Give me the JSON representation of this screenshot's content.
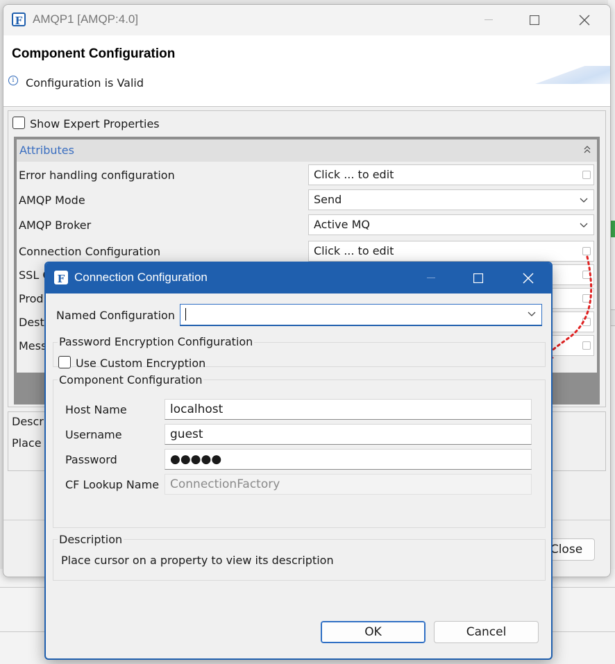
{
  "outer_window": {
    "title": "AMQP1 [AMQP:4.0]",
    "header_title": "Component Configuration",
    "status": "Configuration is Valid",
    "show_expert_label": "Show Expert Properties",
    "attributes_header": "Attributes",
    "properties": [
      {
        "label": "Error handling configuration",
        "value": "Click ... to edit",
        "kind": "edit"
      },
      {
        "label": "AMQP Mode",
        "value": "Send",
        "kind": "select"
      },
      {
        "label": "AMQP Broker",
        "value": "Active MQ",
        "kind": "select"
      },
      {
        "label": "Connection Configuration",
        "value": "Click ... to edit",
        "kind": "edit"
      },
      {
        "label": "SSL C",
        "value": "",
        "kind": "edit"
      },
      {
        "label": "Prod",
        "value": "",
        "kind": "edit"
      },
      {
        "label": "Desti",
        "value": "",
        "kind": "edit"
      },
      {
        "label": "Mess",
        "value": "",
        "kind": "edit"
      }
    ],
    "description_title": "Descri",
    "description_text": "Place c",
    "close_button": "Close"
  },
  "dialog": {
    "title": "Connection Configuration",
    "named_config_label": "Named Configuration",
    "named_config_value": "",
    "password_encryption_group": "Password Encryption Configuration",
    "use_custom_encryption_label": "Use Custom Encryption",
    "component_config_group": "Component Configuration",
    "fields": [
      {
        "label": "Host Name",
        "value": "localhost",
        "disabled": false
      },
      {
        "label": "Username",
        "value": "guest",
        "disabled": false
      },
      {
        "label": "Password",
        "value": "●●●●●",
        "disabled": false
      },
      {
        "label": "CF Lookup Name",
        "value": "ConnectionFactory",
        "disabled": true
      }
    ],
    "description_group": "Description",
    "description_text": "Place cursor on a property to view its description",
    "ok_button": "OK",
    "cancel_button": "Cancel"
  },
  "colors": {
    "dialog_titlebar": "#1f5fae",
    "attributes_header_text": "#3a6ec0",
    "annotation_arrow": "#e02020"
  }
}
